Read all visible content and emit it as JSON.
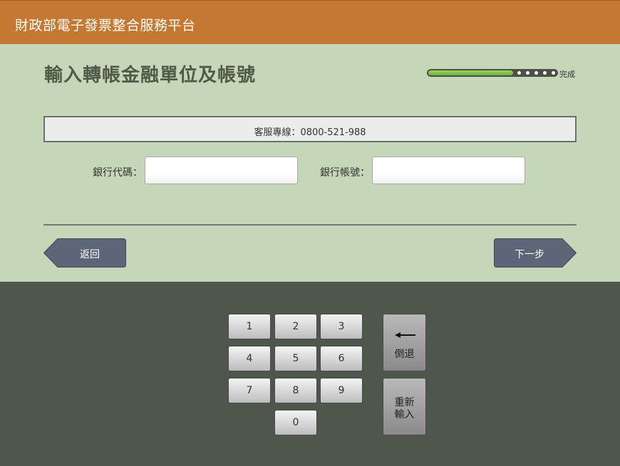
{
  "header": {
    "app_title": "財政部電子發票整合服務平台"
  },
  "page": {
    "title": "輸入轉帳金融單位及帳號"
  },
  "progress": {
    "fraction": 0.66,
    "label": "完成"
  },
  "info": {
    "text": "客服專線：0800-521-988"
  },
  "form": {
    "bank_code": {
      "label": "銀行代碼：",
      "value": "",
      "placeholder": ""
    },
    "account_no": {
      "label": "銀行帳號：",
      "value": "",
      "placeholder": ""
    }
  },
  "nav": {
    "back_label": "返回",
    "next_label": "下一步"
  },
  "keypad": {
    "digits": [
      "1",
      "2",
      "3",
      "4",
      "5",
      "6",
      "7",
      "8",
      "9",
      "0"
    ],
    "backspace_label": "倒退",
    "reset_label_line1": "重新",
    "reset_label_line2": "輸入"
  },
  "colors": {
    "header_bg": "#c57831",
    "panel_bg": "#c5d6b9",
    "keypad_bg": "#4f564c",
    "nav_button": "#5d6679",
    "progress_fill": "#7dbf47"
  }
}
